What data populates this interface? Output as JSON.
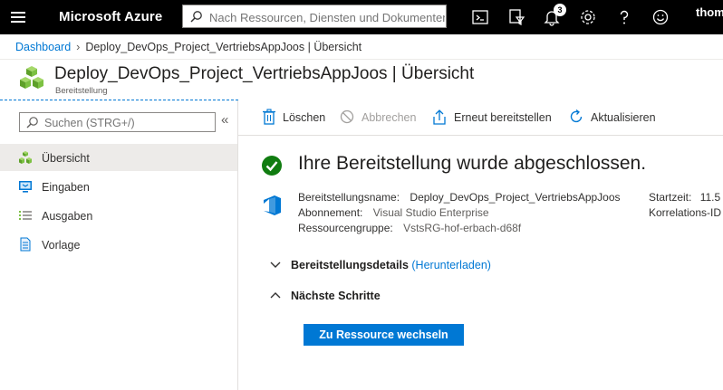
{
  "topbar": {
    "brand": "Microsoft Azure",
    "search_placeholder": "Nach Ressourcen, Diensten und Dokumenten suchen (G+/)",
    "notification_count": "3",
    "user": "thomas",
    "colors": {
      "bar": "#000000",
      "accent": "#0078d4"
    }
  },
  "breadcrumb": {
    "items": [
      "Dashboard",
      "Deploy_DevOps_Project_VertriebsAppJoos | Übersicht"
    ]
  },
  "header": {
    "title": "Deploy_DevOps_Project_VertriebsAppJoos | Übersicht",
    "subtitle": "Bereitstellung"
  },
  "sidebar": {
    "search_placeholder": "Suchen (STRG+/)",
    "collapse_glyph": "«",
    "items": [
      {
        "label": "Übersicht",
        "icon": "overview-icon",
        "active": true
      },
      {
        "label": "Eingaben",
        "icon": "inputs-icon"
      },
      {
        "label": "Ausgaben",
        "icon": "outputs-icon"
      },
      {
        "label": "Vorlage",
        "icon": "template-icon"
      }
    ]
  },
  "toolbar": {
    "delete": "Löschen",
    "cancel": "Abbrechen",
    "redeploy": "Erneut bereitstellen",
    "refresh": "Aktualisieren"
  },
  "status": {
    "headline": "Ihre Bereitstellung wurde abgeschlossen.",
    "deployment_name_label": "Bereitstellungsname:",
    "deployment_name": "Deploy_DevOps_Project_VertriebsAppJoos",
    "subscription_label": "Abonnement:",
    "subscription": "Visual Studio Enterprise",
    "resource_group_label": "Ressourcengruppe:",
    "resource_group": "VstsRG-hof-erbach-d68f",
    "start_time_label": "Startzeit:",
    "start_time": "11.5",
    "correlation_label": "Korrelations-ID"
  },
  "sections": {
    "details": "Bereitstellungsdetails",
    "download": "(Herunterladen)",
    "next_steps": "Nächste Schritte"
  },
  "actions": {
    "go_to_resource": "Zu Ressource wechseln"
  }
}
